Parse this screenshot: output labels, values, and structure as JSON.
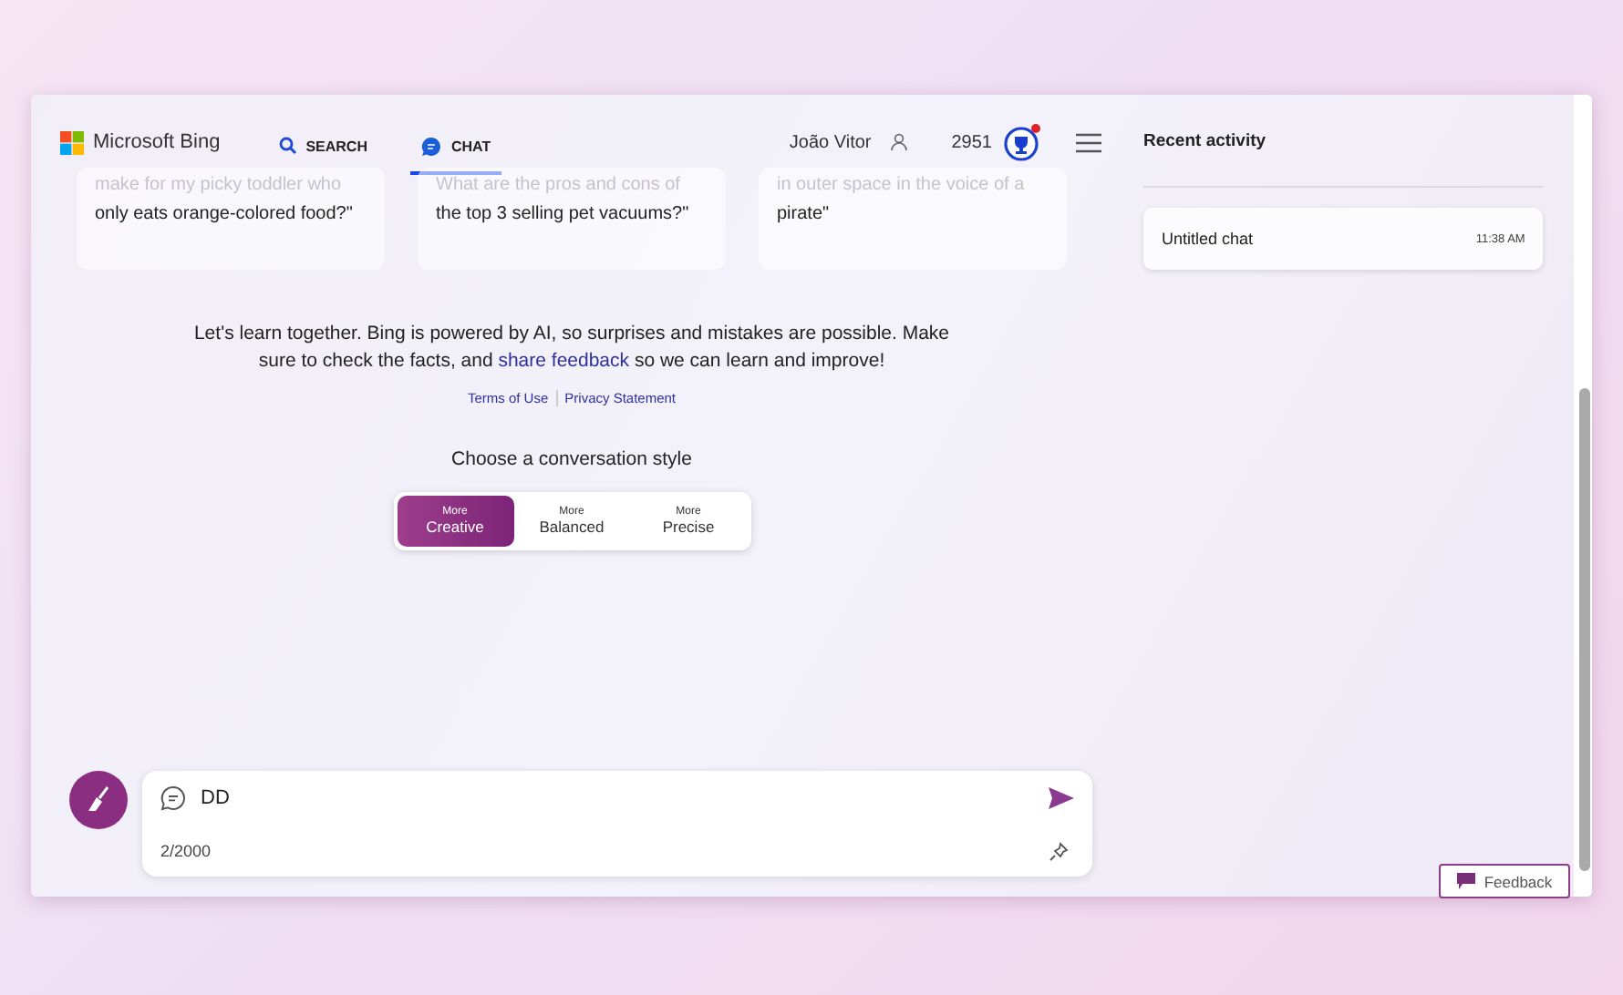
{
  "header": {
    "brand": "Microsoft Bing",
    "tabs": [
      {
        "label": "SEARCH",
        "kind": "search",
        "selected": false
      },
      {
        "label": "CHAT",
        "kind": "chat",
        "selected": true
      }
    ],
    "user_name": "João Vitor",
    "points": "2951",
    "rewards_notification": true
  },
  "prompt_cards": [
    {
      "faded_line": "make for my picky toddler who",
      "text": "only eats orange-colored food?\""
    },
    {
      "faded_line": "What are the pros and cons of",
      "text": "the top 3 selling pet vacuums?\""
    },
    {
      "faded_line": "in outer space in the voice of a",
      "text": "pirate\""
    }
  ],
  "disclaimer": {
    "before": "Let's learn together. Bing is powered by AI, so surprises and mistakes are possible. Make sure to check the facts, and",
    "link": "share feedback",
    "after": "so we can learn and improve!"
  },
  "legal_links": [
    "Terms of Use",
    "Privacy Statement"
  ],
  "style_chooser": {
    "title": "Choose a conversation style",
    "options": [
      {
        "kicker": "More",
        "label": "Creative",
        "selected": true
      },
      {
        "kicker": "More",
        "label": "Balanced",
        "selected": false
      },
      {
        "kicker": "More",
        "label": "Precise",
        "selected": false
      }
    ]
  },
  "composer": {
    "value": "DD",
    "counter": "2/2000"
  },
  "recent_activity": {
    "title": "Recent activity",
    "items": [
      {
        "title": "Untitled chat",
        "time": "11:38 AM"
      }
    ]
  },
  "feedback_button": "Feedback"
}
